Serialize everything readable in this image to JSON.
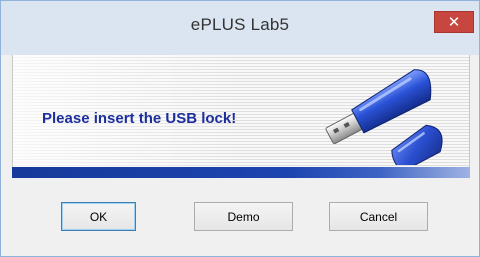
{
  "window": {
    "title": "ePLUS Lab5",
    "close_icon": "close-icon"
  },
  "banner": {
    "message": "Please insert the USB lock!",
    "image": "usb-dongle-icon"
  },
  "buttons": {
    "ok_label": "OK",
    "demo_label": "Demo",
    "cancel_label": "Cancel"
  },
  "colors": {
    "message_text": "#1d2f9c",
    "strip": "#1c44b0",
    "close_button": "#c7463f"
  }
}
